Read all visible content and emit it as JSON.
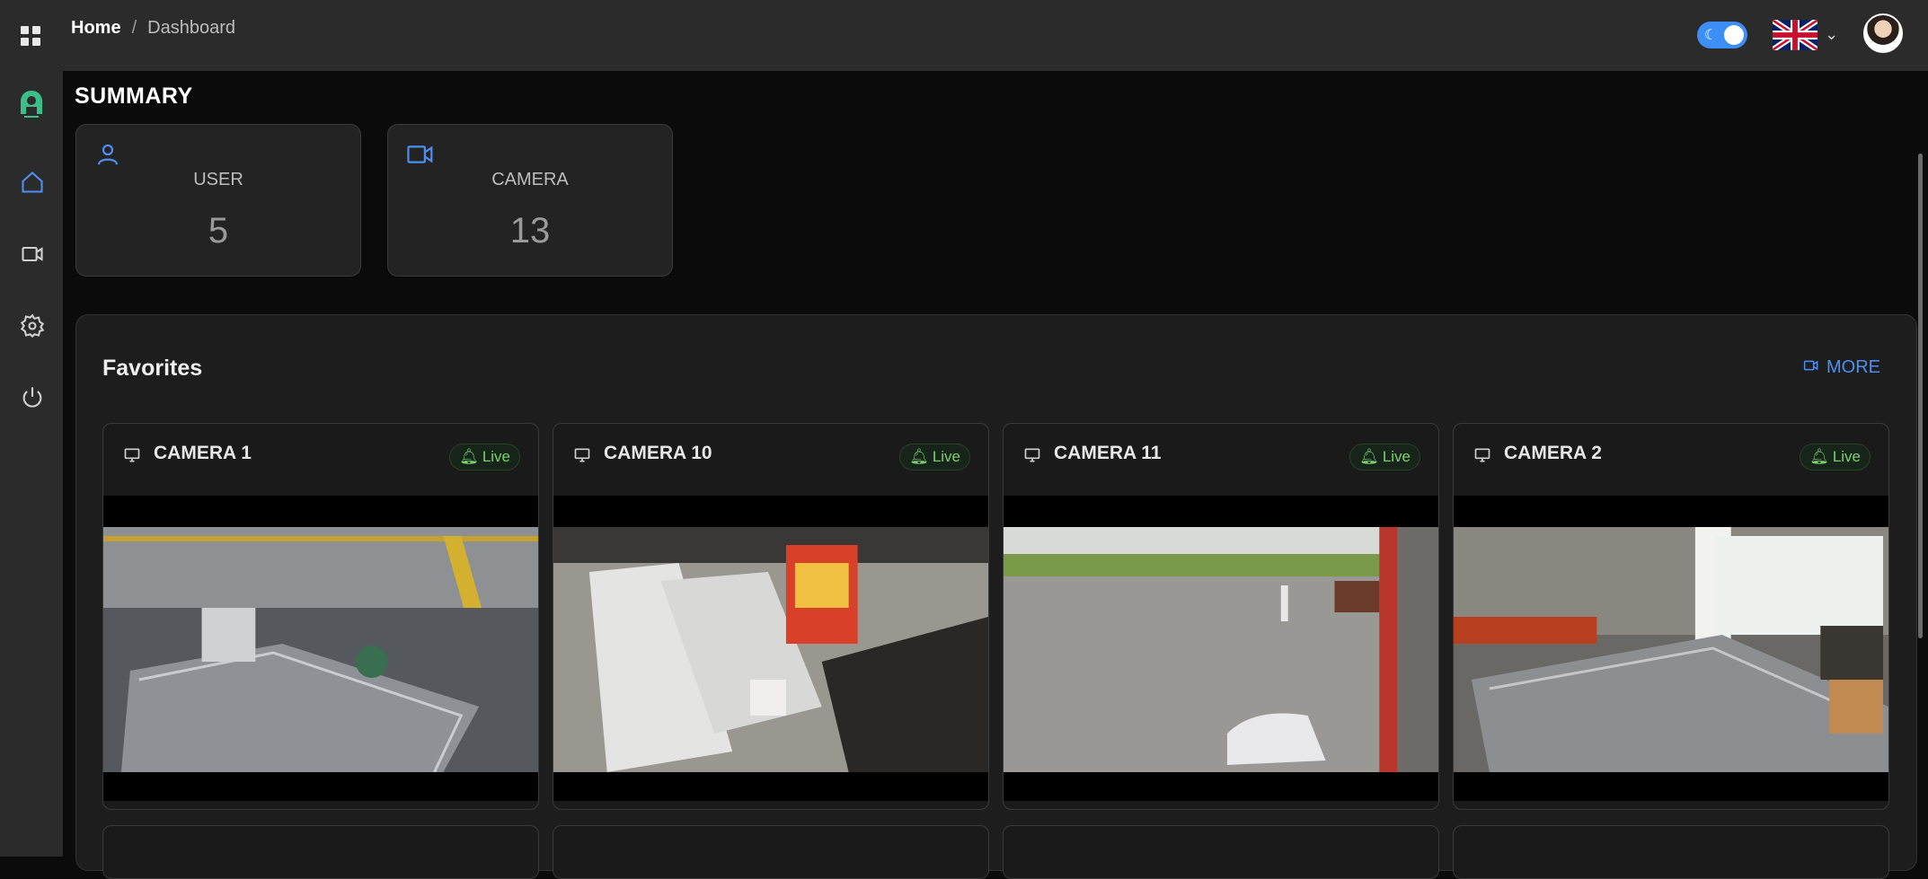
{
  "header": {
    "breadcrumb": {
      "home": "Home",
      "separator": "/",
      "current": "Dashboard"
    },
    "icons": {
      "apps": "grid-icon",
      "theme": "moon-icon",
      "language": "uk-flag-icon",
      "dropdown": "chevron-down-icon"
    },
    "theme_toggle": {
      "state": "dark",
      "accent": "#3e8ef7"
    }
  },
  "sidebar": {
    "items": [
      {
        "name": "logo",
        "icon": "brand-logo-icon"
      },
      {
        "name": "home",
        "icon": "home-icon",
        "active": true
      },
      {
        "name": "camera",
        "icon": "video-camera-icon"
      },
      {
        "name": "settings",
        "icon": "gear-icon"
      },
      {
        "name": "logout",
        "icon": "power-icon"
      }
    ]
  },
  "summary": {
    "title": "SUMMARY",
    "cards": [
      {
        "label": "USER",
        "value": "5",
        "icon": "user-icon"
      },
      {
        "label": "CAMERA",
        "value": "13",
        "icon": "video-camera-icon"
      }
    ]
  },
  "favorites": {
    "title": "Favorites",
    "more_label": "MORE",
    "live_label": "Live",
    "cameras": [
      {
        "name": "CAMERA 1",
        "status": "Live"
      },
      {
        "name": "CAMERA 10",
        "status": "Live"
      },
      {
        "name": "CAMERA 11",
        "status": "Live"
      },
      {
        "name": "CAMERA 2",
        "status": "Live"
      }
    ]
  },
  "colors": {
    "accent": "#4d8ff0",
    "live_green": "#7ad36a",
    "panel": "#1d1d1e",
    "topbar": "#2b2b2c"
  }
}
